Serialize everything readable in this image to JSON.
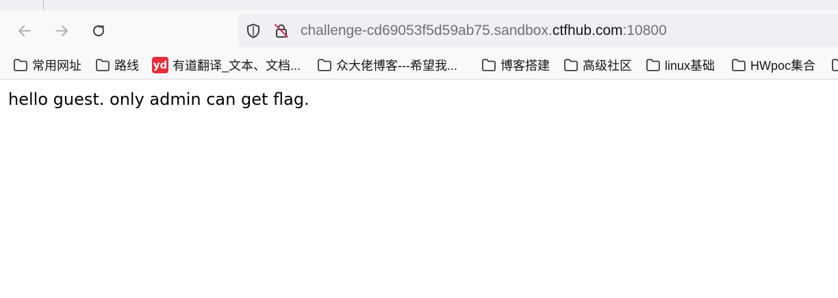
{
  "browser": {
    "url": {
      "prefix": "challenge-cd69053f5d59ab75.sandbox.",
      "domain": "ctfhub.com",
      "port": ":10800"
    },
    "bookmarks": [
      {
        "label": "常用网址",
        "icon": "folder-icon"
      },
      {
        "label": "路线",
        "icon": "folder-icon"
      },
      {
        "label": "有道翻译_文本、文档...",
        "icon": "youdao-icon",
        "icon_text": "yd"
      },
      {
        "label": "众大佬博客---希望我...",
        "icon": "folder-icon"
      },
      {
        "label": "博客搭建",
        "icon": "folder-icon"
      },
      {
        "label": "高级社区",
        "icon": "folder-icon"
      },
      {
        "label": "linux基础",
        "icon": "folder-icon"
      },
      {
        "label": "HWpoc集合",
        "icon": "folder-icon"
      }
    ]
  },
  "page": {
    "message": "hello guest. only admin can get flag."
  },
  "colors": {
    "youdao_brand": "#e82c3a",
    "tabstrip": "#f0f0f4",
    "toolbar": "#f9f9fb"
  }
}
